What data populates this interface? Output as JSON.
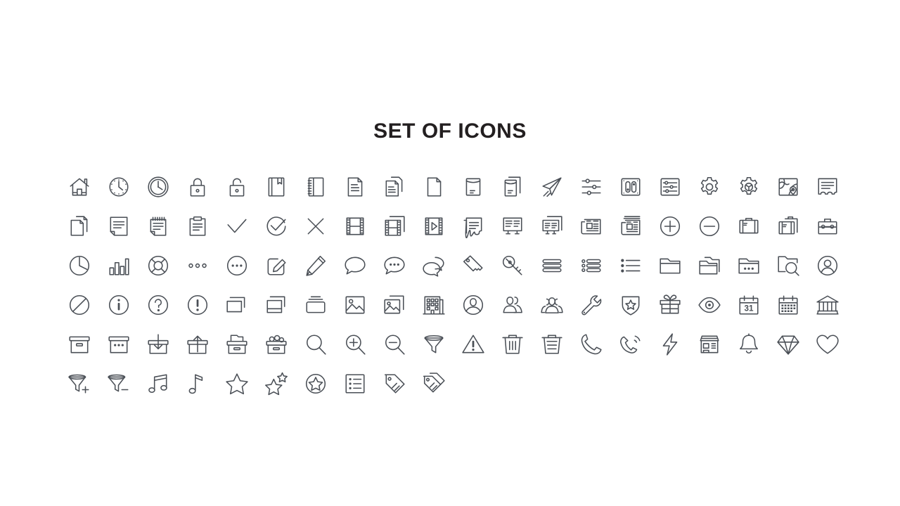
{
  "page": {
    "title": "SET OF ICONS",
    "background_color": "#ffffff",
    "title_color": "#231f20",
    "icon_stroke_color": "#4a4f56"
  },
  "grid": {
    "columns": 20,
    "rows": 6,
    "total_icons": 110
  },
  "rows": [
    {
      "index": 1,
      "icons": [
        {
          "name": "home-icon",
          "label": "home"
        },
        {
          "name": "clock-dotted-icon",
          "label": "clock dotted"
        },
        {
          "name": "clock-double-circle-icon",
          "label": "clock"
        },
        {
          "name": "lock-closed-icon",
          "label": "lock closed"
        },
        {
          "name": "lock-open-icon",
          "label": "lock open"
        },
        {
          "name": "book-bookmark-icon",
          "label": "book with bookmark"
        },
        {
          "name": "notebook-spiral-icon",
          "label": "spiral notebook"
        },
        {
          "name": "document-text-icon",
          "label": "document"
        },
        {
          "name": "document-copy-icon",
          "label": "document copy"
        },
        {
          "name": "document-blank-icon",
          "label": "blank document"
        },
        {
          "name": "envelope-open-icon",
          "label": "envelope"
        },
        {
          "name": "envelope-copy-icon",
          "label": "envelope copy"
        },
        {
          "name": "send-plane-icon",
          "label": "send"
        },
        {
          "name": "sliders-horizontal-icon",
          "label": "sliders"
        },
        {
          "name": "toggle-panel-icon",
          "label": "toggle panel"
        },
        {
          "name": "settings-panel-icon",
          "label": "settings panel"
        },
        {
          "name": "gear-icon",
          "label": "gear"
        },
        {
          "name": "gear-badge-icon",
          "label": "gear badge"
        },
        {
          "name": "map-pin-icon",
          "label": "map"
        },
        {
          "name": "certificate-icon",
          "label": "certificate"
        }
      ]
    },
    {
      "index": 2,
      "icons": [
        {
          "name": "copy-documents-icon",
          "label": "copy documents"
        },
        {
          "name": "note-folded-icon",
          "label": "note"
        },
        {
          "name": "notepad-spiral-icon",
          "label": "notepad"
        },
        {
          "name": "clipboard-icon",
          "label": "clipboard"
        },
        {
          "name": "check-icon",
          "label": "check"
        },
        {
          "name": "check-circle-icon",
          "label": "check circle"
        },
        {
          "name": "close-x-icon",
          "label": "close"
        },
        {
          "name": "film-strip-icon",
          "label": "film strip"
        },
        {
          "name": "film-copy-icon",
          "label": "film copy"
        },
        {
          "name": "video-play-icon",
          "label": "video play"
        },
        {
          "name": "receipt-icon",
          "label": "receipt"
        },
        {
          "name": "presentation-icon",
          "label": "presentation"
        },
        {
          "name": "presentation-copy-icon",
          "label": "presentation copy"
        },
        {
          "name": "newspaper-icon",
          "label": "newspaper"
        },
        {
          "name": "newspaper-stack-icon",
          "label": "newspaper stack"
        },
        {
          "name": "plus-circle-icon",
          "label": "plus circle"
        },
        {
          "name": "minus-circle-icon",
          "label": "minus circle"
        },
        {
          "name": "briefcase-icon",
          "label": "briefcase"
        },
        {
          "name": "briefcase-copy-icon",
          "label": "briefcase copy"
        },
        {
          "name": "toolbox-icon",
          "label": "toolbox"
        }
      ]
    },
    {
      "index": 3,
      "icons": [
        {
          "name": "pie-chart-icon",
          "label": "pie chart"
        },
        {
          "name": "bar-chart-icon",
          "label": "bar chart"
        },
        {
          "name": "lifebuoy-icon",
          "label": "lifebuoy"
        },
        {
          "name": "dots-horizontal-icon",
          "label": "more"
        },
        {
          "name": "dots-circle-icon",
          "label": "more circle"
        },
        {
          "name": "edit-square-icon",
          "label": "edit"
        },
        {
          "name": "pencil-icon",
          "label": "pencil"
        },
        {
          "name": "chat-bubble-icon",
          "label": "chat"
        },
        {
          "name": "chat-dots-icon",
          "label": "chat dots"
        },
        {
          "name": "chat-double-icon",
          "label": "chat double"
        },
        {
          "name": "key-icon",
          "label": "key"
        },
        {
          "name": "keys-double-icon",
          "label": "keys"
        },
        {
          "name": "menu-bars-icon",
          "label": "menu"
        },
        {
          "name": "list-bars-icon",
          "label": "list"
        },
        {
          "name": "bullet-list-icon",
          "label": "bullet list"
        },
        {
          "name": "folder-icon",
          "label": "folder"
        },
        {
          "name": "folders-icon",
          "label": "folders"
        },
        {
          "name": "folder-dots-icon",
          "label": "folder options"
        },
        {
          "name": "folder-search-icon",
          "label": "folder search"
        },
        {
          "name": "user-circle-icon",
          "label": "user"
        }
      ]
    },
    {
      "index": 4,
      "icons": [
        {
          "name": "ban-circle-icon",
          "label": "ban"
        },
        {
          "name": "info-circle-icon",
          "label": "info"
        },
        {
          "name": "question-circle-icon",
          "label": "help"
        },
        {
          "name": "exclamation-circle-icon",
          "label": "alert"
        },
        {
          "name": "windows-layers-icon",
          "label": "windows"
        },
        {
          "name": "layers-stack-icon",
          "label": "layers"
        },
        {
          "name": "drawer-stack-icon",
          "label": "drawer"
        },
        {
          "name": "image-icon",
          "label": "image"
        },
        {
          "name": "images-copy-icon",
          "label": "images"
        },
        {
          "name": "building-icon",
          "label": "building"
        },
        {
          "name": "user-avatar-circle-icon",
          "label": "avatar"
        },
        {
          "name": "users-two-icon",
          "label": "two users"
        },
        {
          "name": "users-three-icon",
          "label": "group"
        },
        {
          "name": "wrench-icon",
          "label": "wrench"
        },
        {
          "name": "shield-star-icon",
          "label": "shield"
        },
        {
          "name": "gift-icon",
          "label": "gift"
        },
        {
          "name": "eye-icon",
          "label": "eye"
        },
        {
          "name": "calendar-date-icon",
          "label": "calendar 31",
          "text": "31"
        },
        {
          "name": "calendar-grid-icon",
          "label": "calendar"
        },
        {
          "name": "bank-icon",
          "label": "bank"
        }
      ]
    },
    {
      "index": 5,
      "icons": [
        {
          "name": "archive-box-icon",
          "label": "archive"
        },
        {
          "name": "archive-dots-icon",
          "label": "archive options"
        },
        {
          "name": "inbox-download-icon",
          "label": "inbox"
        },
        {
          "name": "outbox-upload-icon",
          "label": "outbox"
        },
        {
          "name": "archive-file-icon",
          "label": "archive file"
        },
        {
          "name": "archive-full-icon",
          "label": "archive full"
        },
        {
          "name": "search-icon",
          "label": "search"
        },
        {
          "name": "zoom-in-icon",
          "label": "zoom in"
        },
        {
          "name": "zoom-out-icon",
          "label": "zoom out"
        },
        {
          "name": "funnel-icon",
          "label": "filter"
        },
        {
          "name": "warning-triangle-icon",
          "label": "warning"
        },
        {
          "name": "trash-icon",
          "label": "trash"
        },
        {
          "name": "trash-lines-icon",
          "label": "delete"
        },
        {
          "name": "phone-icon",
          "label": "phone"
        },
        {
          "name": "phone-ring-icon",
          "label": "call"
        },
        {
          "name": "bolt-icon",
          "label": "flash"
        },
        {
          "name": "storefront-icon",
          "label": "store"
        },
        {
          "name": "bell-icon",
          "label": "notifications"
        },
        {
          "name": "diamond-icon",
          "label": "diamond"
        },
        {
          "name": "heart-icon",
          "label": "favorite"
        }
      ]
    },
    {
      "index": 6,
      "icons": [
        {
          "name": "filter-add-icon",
          "label": "add filter"
        },
        {
          "name": "filter-remove-icon",
          "label": "remove filter"
        },
        {
          "name": "music-notes-icon",
          "label": "music"
        },
        {
          "name": "music-note-icon",
          "label": "note"
        },
        {
          "name": "star-icon",
          "label": "star"
        },
        {
          "name": "stars-icon",
          "label": "stars"
        },
        {
          "name": "star-circle-icon",
          "label": "star circle"
        },
        {
          "name": "checklist-icon",
          "label": "checklist"
        },
        {
          "name": "tag-icon",
          "label": "tag"
        },
        {
          "name": "tags-icon",
          "label": "tags"
        }
      ]
    }
  ]
}
